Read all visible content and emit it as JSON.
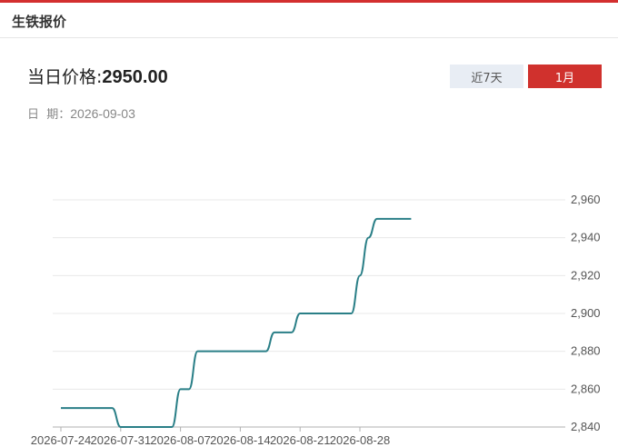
{
  "header": {
    "title": "生铁报价"
  },
  "price": {
    "label": "当日价格:",
    "value": "2950.00"
  },
  "date": {
    "label": "日  期：",
    "value": "2026-09-03"
  },
  "range_buttons": {
    "week": "近7天",
    "month": "1月",
    "active": "1月"
  },
  "colors": {
    "accent": "#d32f2f",
    "line": "#2a7f87",
    "active_button": "#d0312d",
    "inactive_button": "#e8edf4"
  },
  "chart_data": {
    "type": "line",
    "title": "",
    "xlabel": "",
    "ylabel": "",
    "y_axis_position": "right",
    "ylim": [
      2840,
      2960
    ],
    "y_ticks": [
      "2,840",
      "2,860",
      "2,880",
      "2,900",
      "2,920",
      "2,940",
      "2,960"
    ],
    "x_tick_labels": [
      "2026-07-24",
      "2026-07-31",
      "2026-08-07",
      "2026-08-14",
      "2026-08-21",
      "2026-08-28"
    ],
    "smooth": true,
    "grid": true,
    "series": [
      {
        "x": [
          "2026-07-24",
          "2026-07-25",
          "2026-07-26",
          "2026-07-27",
          "2026-07-28",
          "2026-07-29",
          "2026-07-30",
          "2026-07-31",
          "2026-08-01",
          "2026-08-02",
          "2026-08-03",
          "2026-08-04",
          "2026-08-05",
          "2026-08-06",
          "2026-08-07",
          "2026-08-08",
          "2026-08-09",
          "2026-08-10",
          "2026-08-11",
          "2026-08-12",
          "2026-08-13",
          "2026-08-14",
          "2026-08-15",
          "2026-08-16",
          "2026-08-17",
          "2026-08-18",
          "2026-08-19",
          "2026-08-20",
          "2026-08-21",
          "2026-08-22",
          "2026-08-23",
          "2026-08-24",
          "2026-08-25",
          "2026-08-26",
          "2026-08-27",
          "2026-08-28",
          "2026-08-29",
          "2026-08-30",
          "2026-08-31",
          "2026-09-01",
          "2026-09-02",
          "2026-09-03"
        ],
        "values": [
          2850,
          2850,
          2850,
          2850,
          2850,
          2850,
          2850,
          2840,
          2840,
          2840,
          2840,
          2840,
          2840,
          2840,
          2860,
          2860,
          2880,
          2880,
          2880,
          2880,
          2880,
          2880,
          2880,
          2880,
          2880,
          2890,
          2890,
          2890,
          2900,
          2900,
          2900,
          2900,
          2900,
          2900,
          2900,
          2920,
          2940,
          2950,
          2950,
          2950,
          2950,
          2950
        ]
      }
    ]
  }
}
